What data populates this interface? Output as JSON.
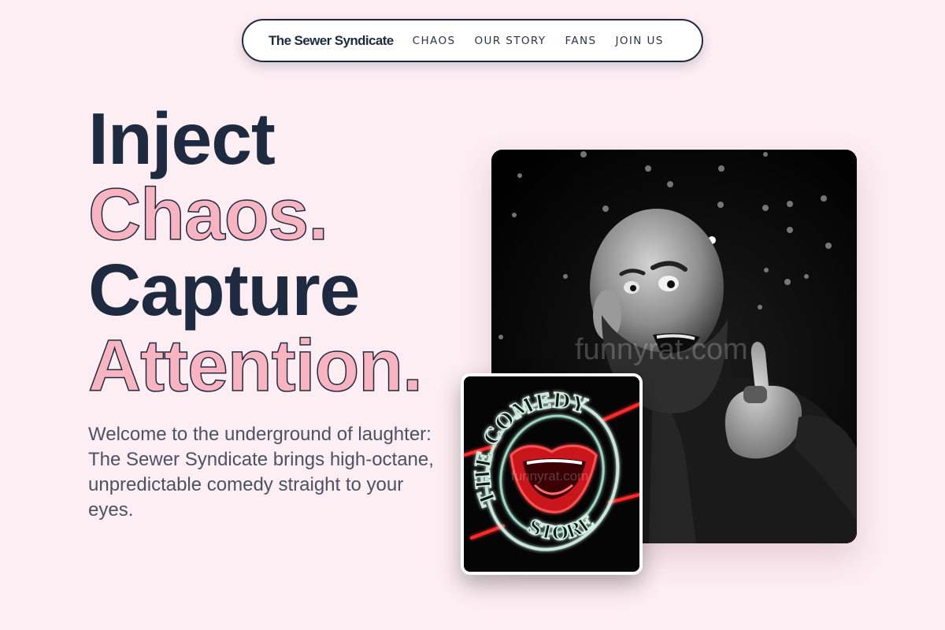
{
  "nav": {
    "brand": "The Sewer Syndicate",
    "links": [
      "CHAOS",
      "OUR STORY",
      "FANS",
      "JOIN US"
    ]
  },
  "hero": {
    "line1": "Inject",
    "line2": "Chaos.",
    "line3": "Capture",
    "line4": "Attention.",
    "description": "Welcome to the underground of laughter: The Sewer Syndicate brings high-octane, unpredictable comedy straight to your eyes."
  },
  "images": {
    "main_watermark": "funnyrat.com",
    "small_watermark": "funnyrat.com",
    "sign_top_text": "THE COMEDY",
    "sign_bottom_text": "STORE"
  },
  "colors": {
    "background": "#fdeef3",
    "text_dark": "#1e2a40",
    "accent_pink": "#f8b4c0",
    "body_text": "#4a5266"
  }
}
